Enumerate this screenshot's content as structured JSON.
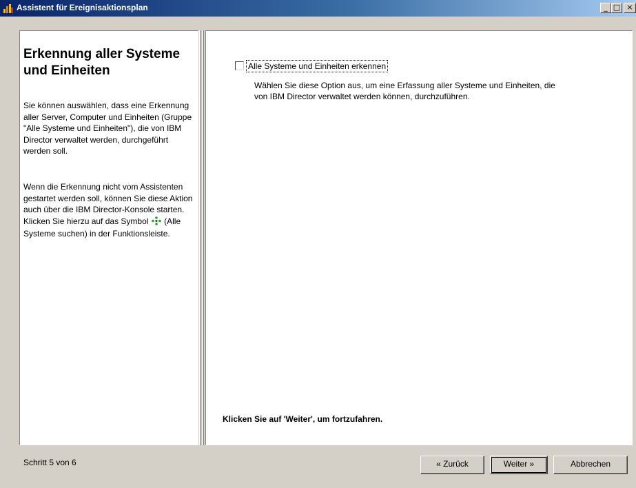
{
  "window": {
    "title": "Assistent für Ereignisaktionsplan",
    "controls": {
      "minimize": "_",
      "maximize": "□",
      "close": "×"
    }
  },
  "left_panel": {
    "heading": "Erkennung aller Systeme und Einheiten",
    "paragraph1": "Sie können auswählen, dass eine Erkennung aller Server, Computer und Einheiten (Gruppe \"Alle Systeme und Einheiten\"), die von IBM Director verwaltet werden, durchgeführt werden soll.",
    "paragraph2_before_icon": "Wenn die Erkennung nicht vom Assistenten gestartet werden soll, können Sie diese Aktion auch über die IBM Director-Konsole starten. Klicken Sie hierzu auf das Symbol",
    "paragraph2_after_icon": "(Alle Systeme suchen) in der Funktionsleiste."
  },
  "right_panel": {
    "checkbox_label": "Alle Systeme und Einheiten erkennen",
    "checkbox_checked": false,
    "option_description": "Wählen Sie diese Option aus, um eine Erfassung aller Systeme und Einheiten, die von IBM Director verwaltet werden können, durchzuführen.",
    "hint": "Klicken Sie auf 'Weiter', um fortzufahren."
  },
  "footer": {
    "step": "Schritt 5 von 6",
    "back_label": "« Zurück",
    "next_label": "Weiter »",
    "cancel_label": "Abbrechen"
  },
  "icons": {
    "app": "wizard-app-icon",
    "discover_all_systems": "discover-all-systems-icon"
  },
  "colors": {
    "titlebar_start": "#0a246a",
    "titlebar_end": "#a6caf0",
    "window_background": "#d4d0c8",
    "discover_icon": "#2e9e2e"
  }
}
